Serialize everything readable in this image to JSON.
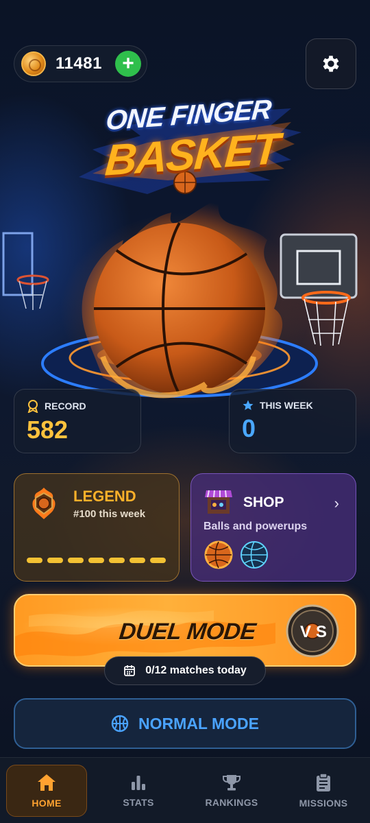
{
  "header": {
    "coins": "11481",
    "add_label": "+"
  },
  "logo": {
    "line1": "ONE FINGER",
    "line2": "BASKET"
  },
  "stats": {
    "record_label": "RECORD",
    "record_value": "582",
    "week_label": "THIS WEEK",
    "week_value": "0"
  },
  "legend": {
    "title": "LEGEND",
    "subtitle": "#100 this week",
    "progress_segments": 7
  },
  "shop": {
    "title": "SHOP",
    "subtitle": "Balls and powerups",
    "chevron": "›"
  },
  "duel": {
    "label": "DUEL MODE",
    "badge": "VS",
    "matches": "0/12 matches today"
  },
  "normal": {
    "label": "NORMAL MODE"
  },
  "nav": {
    "home": "HOME",
    "stats": "STATS",
    "rankings": "RANKINGS",
    "missions": "MISSIONS"
  },
  "colors": {
    "accent_orange": "#ffa230",
    "record_gold": "#ffc23d",
    "week_blue": "#4aa8ff",
    "shop_purple": "#46307a",
    "add_green": "#2fbf4c"
  },
  "icons": {
    "coin": "coin-icon",
    "add": "plus-icon",
    "settings": "gear-icon",
    "record": "medal-icon",
    "week": "star-icon",
    "legend": "flame-badge-icon",
    "shop": "shop-stall-icon",
    "calendar": "calendar-icon",
    "normal": "basketball-icon",
    "home": "home-icon",
    "stats": "bar-chart-icon",
    "rankings": "trophy-icon",
    "missions": "clipboard-icon"
  }
}
